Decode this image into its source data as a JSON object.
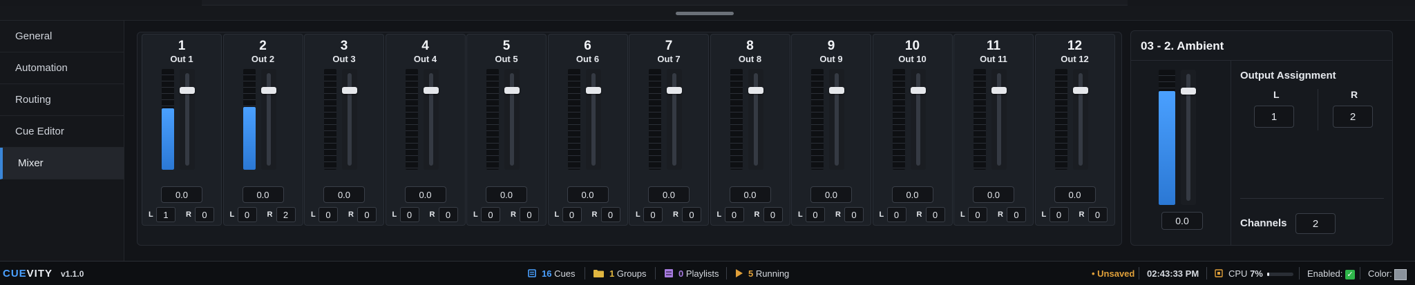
{
  "sidebar": {
    "items": [
      {
        "label": "General"
      },
      {
        "label": "Automation"
      },
      {
        "label": "Routing"
      },
      {
        "label": "Cue Editor"
      },
      {
        "label": "Mixer",
        "active": true
      }
    ]
  },
  "mixer": {
    "strips": [
      {
        "num": "1",
        "out": "Out 1",
        "gain": "0.0",
        "l": "1",
        "r": "0",
        "level": 0.61
      },
      {
        "num": "2",
        "out": "Out 2",
        "gain": "0.0",
        "l": "0",
        "r": "2",
        "level": 0.62
      },
      {
        "num": "3",
        "out": "Out 3",
        "gain": "0.0",
        "l": "0",
        "r": "0",
        "level": 0
      },
      {
        "num": "4",
        "out": "Out 4",
        "gain": "0.0",
        "l": "0",
        "r": "0",
        "level": 0
      },
      {
        "num": "5",
        "out": "Out 5",
        "gain": "0.0",
        "l": "0",
        "r": "0",
        "level": 0
      },
      {
        "num": "6",
        "out": "Out 6",
        "gain": "0.0",
        "l": "0",
        "r": "0",
        "level": 0
      },
      {
        "num": "7",
        "out": "Out 7",
        "gain": "0.0",
        "l": "0",
        "r": "0",
        "level": 0
      },
      {
        "num": "8",
        "out": "Out 8",
        "gain": "0.0",
        "l": "0",
        "r": "0",
        "level": 0
      },
      {
        "num": "9",
        "out": "Out 9",
        "gain": "0.0",
        "l": "0",
        "r": "0",
        "level": 0
      },
      {
        "num": "10",
        "out": "Out 10",
        "gain": "0.0",
        "l": "0",
        "r": "0",
        "level": 0
      },
      {
        "num": "11",
        "out": "Out 11",
        "gain": "0.0",
        "l": "0",
        "r": "0",
        "level": 0
      },
      {
        "num": "12",
        "out": "Out 12",
        "gain": "0.0",
        "l": "0",
        "r": "0",
        "level": 0
      }
    ],
    "l_label": "L",
    "r_label": "R"
  },
  "detail": {
    "title": "03 - 2. Ambient",
    "gain": "0.0",
    "level": 0.84,
    "output_assignment_label": "Output Assignment",
    "l_label": "L",
    "r_label": "R",
    "l_value": "1",
    "r_value": "2",
    "channels_label": "Channels",
    "channels_value": "2"
  },
  "status": {
    "brand_a": "CUE",
    "brand_b": "VITY",
    "version": "v1.1.0",
    "cues_count": "16",
    "cues_label": "Cues",
    "groups_count": "1",
    "groups_label": "Groups",
    "playlists_count": "0",
    "playlists_label": "Playlists",
    "running_count": "5",
    "running_label": "Running",
    "unsaved": "• Unsaved",
    "time": "02:43:33 PM",
    "cpu_label": "CPU",
    "cpu_value": "7%",
    "cpu_fraction": 0.07,
    "enabled_label": "Enabled:",
    "color_label": "Color:",
    "colors": {
      "accent": "#3a86d8",
      "cues": "#4aa0ff",
      "groups": "#e0b640",
      "playlists": "#a77be0",
      "running": "#e0a03a",
      "enabled": "#2fb54a"
    }
  }
}
